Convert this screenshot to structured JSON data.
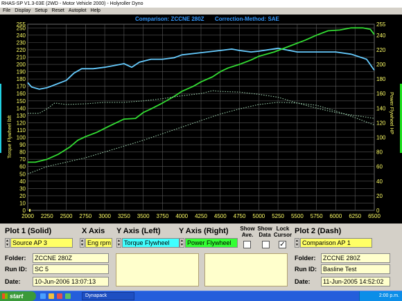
{
  "window": {
    "title": "RHAS-SP V1.3-03E  (2WD - Motor Vehicle 2000) - Holyroller Dyno",
    "menu": [
      "File",
      "Display",
      "Setup",
      "Reset",
      "Autoplot",
      "Help"
    ]
  },
  "chart_header": {
    "comparison": "Comparison: ZCCNE 280Z",
    "correction": "Correction-Method: SAE"
  },
  "chart_data": {
    "type": "line",
    "xlim": [
      2000,
      6500
    ],
    "x_ticks": [
      2000,
      2250,
      2500,
      2750,
      3000,
      3250,
      3500,
      3750,
      4000,
      4250,
      4500,
      4750,
      5000,
      5250,
      5500,
      5750,
      6000,
      6250,
      6500
    ],
    "ylabel_left": "Torque Flywheel lbft",
    "ylabel_right": "Power Flywheel HP",
    "ylim": [
      0,
      255
    ],
    "y_ticks_left": [
      0,
      10,
      20,
      30,
      40,
      50,
      60,
      70,
      80,
      90,
      100,
      110,
      120,
      130,
      140,
      150,
      160,
      170,
      180,
      190,
      200,
      210,
      220,
      230,
      240,
      250,
      255
    ],
    "y_ticks_right": [
      0,
      20,
      40,
      60,
      80,
      100,
      120,
      140,
      160,
      180,
      200,
      220,
      240,
      255
    ],
    "grid": true,
    "series": [
      {
        "name": "Torque Flywheel",
        "style": "solid",
        "color": "#66ccff",
        "points": [
          [
            2000,
            175
          ],
          [
            2050,
            169
          ],
          [
            2150,
            166
          ],
          [
            2250,
            168
          ],
          [
            2350,
            172
          ],
          [
            2500,
            178
          ],
          [
            2600,
            188
          ],
          [
            2700,
            194
          ],
          [
            2850,
            194
          ],
          [
            3000,
            196
          ],
          [
            3150,
            199
          ],
          [
            3250,
            201
          ],
          [
            3350,
            196
          ],
          [
            3450,
            203
          ],
          [
            3600,
            207
          ],
          [
            3750,
            207
          ],
          [
            3900,
            209
          ],
          [
            4000,
            213
          ],
          [
            4250,
            216
          ],
          [
            4500,
            219
          ],
          [
            4650,
            221
          ],
          [
            4750,
            219
          ],
          [
            4900,
            217
          ],
          [
            5000,
            218
          ],
          [
            5250,
            222
          ],
          [
            5400,
            219
          ],
          [
            5500,
            217
          ],
          [
            5750,
            217
          ],
          [
            6000,
            217
          ],
          [
            6200,
            214
          ],
          [
            6400,
            207
          ],
          [
            6500,
            192
          ]
        ]
      },
      {
        "name": "Power Flywheel",
        "style": "solid",
        "color": "#33dd33",
        "points": [
          [
            2000,
            66
          ],
          [
            2100,
            66
          ],
          [
            2250,
            70
          ],
          [
            2400,
            77
          ],
          [
            2550,
            87
          ],
          [
            2650,
            96
          ],
          [
            2750,
            101
          ],
          [
            2900,
            107
          ],
          [
            3050,
            115
          ],
          [
            3250,
            125
          ],
          [
            3400,
            126
          ],
          [
            3500,
            134
          ],
          [
            3600,
            139
          ],
          [
            3750,
            147
          ],
          [
            3900,
            156
          ],
          [
            4000,
            163
          ],
          [
            4150,
            170
          ],
          [
            4250,
            176
          ],
          [
            4400,
            183
          ],
          [
            4500,
            190
          ],
          [
            4600,
            195
          ],
          [
            4750,
            200
          ],
          [
            4900,
            206
          ],
          [
            5000,
            211
          ],
          [
            5200,
            217
          ],
          [
            5400,
            225
          ],
          [
            5600,
            233
          ],
          [
            5750,
            240
          ],
          [
            5900,
            246
          ],
          [
            6050,
            247
          ],
          [
            6200,
            250
          ],
          [
            6350,
            250
          ],
          [
            6450,
            248
          ],
          [
            6500,
            241
          ]
        ]
      },
      {
        "name": "Comparison Torque",
        "style": "dash",
        "color": "#99ccaa",
        "points": [
          [
            2000,
            133
          ],
          [
            2150,
            133
          ],
          [
            2250,
            139
          ],
          [
            2350,
            147
          ],
          [
            2500,
            145
          ],
          [
            2750,
            146
          ],
          [
            3000,
            148
          ],
          [
            3250,
            148
          ],
          [
            3500,
            150
          ],
          [
            3750,
            153
          ],
          [
            4000,
            157
          ],
          [
            4250,
            160
          ],
          [
            4400,
            164
          ],
          [
            4500,
            163
          ],
          [
            4750,
            162
          ],
          [
            5000,
            159
          ],
          [
            5250,
            155
          ],
          [
            5500,
            147
          ],
          [
            5750,
            140
          ],
          [
            6000,
            134
          ],
          [
            6250,
            130
          ],
          [
            6500,
            126
          ]
        ]
      },
      {
        "name": "Comparison Power",
        "style": "dash",
        "color": "#99ccaa",
        "points": [
          [
            2000,
            50
          ],
          [
            2250,
            60
          ],
          [
            2500,
            66
          ],
          [
            2750,
            72
          ],
          [
            3000,
            80
          ],
          [
            3250,
            88
          ],
          [
            3500,
            96
          ],
          [
            3750,
            105
          ],
          [
            4000,
            114
          ],
          [
            4250,
            123
          ],
          [
            4500,
            132
          ],
          [
            4750,
            139
          ],
          [
            5000,
            145
          ],
          [
            5250,
            148
          ],
          [
            5500,
            147
          ],
          [
            5750,
            144
          ],
          [
            6000,
            136
          ],
          [
            6250,
            127
          ],
          [
            6500,
            117
          ]
        ]
      }
    ]
  },
  "panel": {
    "plot1_label": "Plot 1 (Solid)",
    "xaxis_label": "X Axis",
    "yleft_label": "Y Axis (Left)",
    "yright_label": "Y Axis (Right)",
    "show_ave_label": "Show Ave.",
    "show_data_label": "Show Data",
    "lock_cursor_label": "Lock Cursor",
    "plot2_label": "Plot 2 (Dash)",
    "plot1_source": "Source AP 3",
    "xaxis_value": "Eng rpm",
    "yleft_value": "Torque Flywheel",
    "yright_value": "Power Flywheel",
    "lock_cursor_check": "✓",
    "plot2_source": "Comparison AP 1",
    "folder_label": "Folder:",
    "runid_label": "Run ID:",
    "date_label": "Date:",
    "plot1_folder": "ZCCNE 280Z",
    "plot1_runid": "SC 5",
    "plot1_date": "10-Jun-2006  13:07:13",
    "plot2_folder": "ZCCNE 280Z",
    "plot2_runid": "Basline Test",
    "plot2_date": "11-Jun-2005  14:52:02"
  },
  "taskbar": {
    "start_label": "start",
    "task_item": "Dynapack",
    "clock": "2:00 p.m."
  }
}
